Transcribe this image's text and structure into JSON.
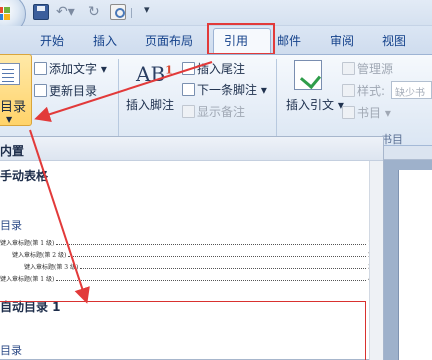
{
  "tabs": [
    "开始",
    "插入",
    "页面布局",
    "引用",
    "邮件",
    "审阅",
    "视图"
  ],
  "active_tab": "引用",
  "ribbon": {
    "toc_group": {
      "toc_button_label": "目录",
      "add_text_label": "添加文字",
      "update_toc_label": "更新目录"
    },
    "footnote_group": {
      "insert_footnote_label": "插入脚注",
      "insert_endnote_label": "插入尾注",
      "next_footnote_label": "下一条脚注",
      "show_notes_label": "显示备注"
    },
    "citation_group": {
      "insert_citation_label": "插入引文",
      "manage_sources_label": "管理源",
      "style_label": "样式:",
      "style_value": "缺少书",
      "bibliography_label": "书目",
      "group_caption": "书目"
    }
  },
  "dropdown": {
    "section_title": "内置",
    "item_manual": "手动表格",
    "preview_heading": "目录",
    "preview_lines": [
      {
        "text": "键入章标题(第 1 级)",
        "page": "1"
      },
      {
        "text": "键入章标题(第 2 级)",
        "page": "2"
      },
      {
        "text": "键入章标题(第 3 级)",
        "page": "3"
      },
      {
        "text": "键入章标题(第 1 级)",
        "page": "4"
      }
    ],
    "item_auto": "自动目录 1",
    "preview2_heading": "目录"
  },
  "colors": {
    "tab_text": "#15428b",
    "highlight_red": "#e23a3a",
    "toc_button_fill": "#ffd36a"
  }
}
